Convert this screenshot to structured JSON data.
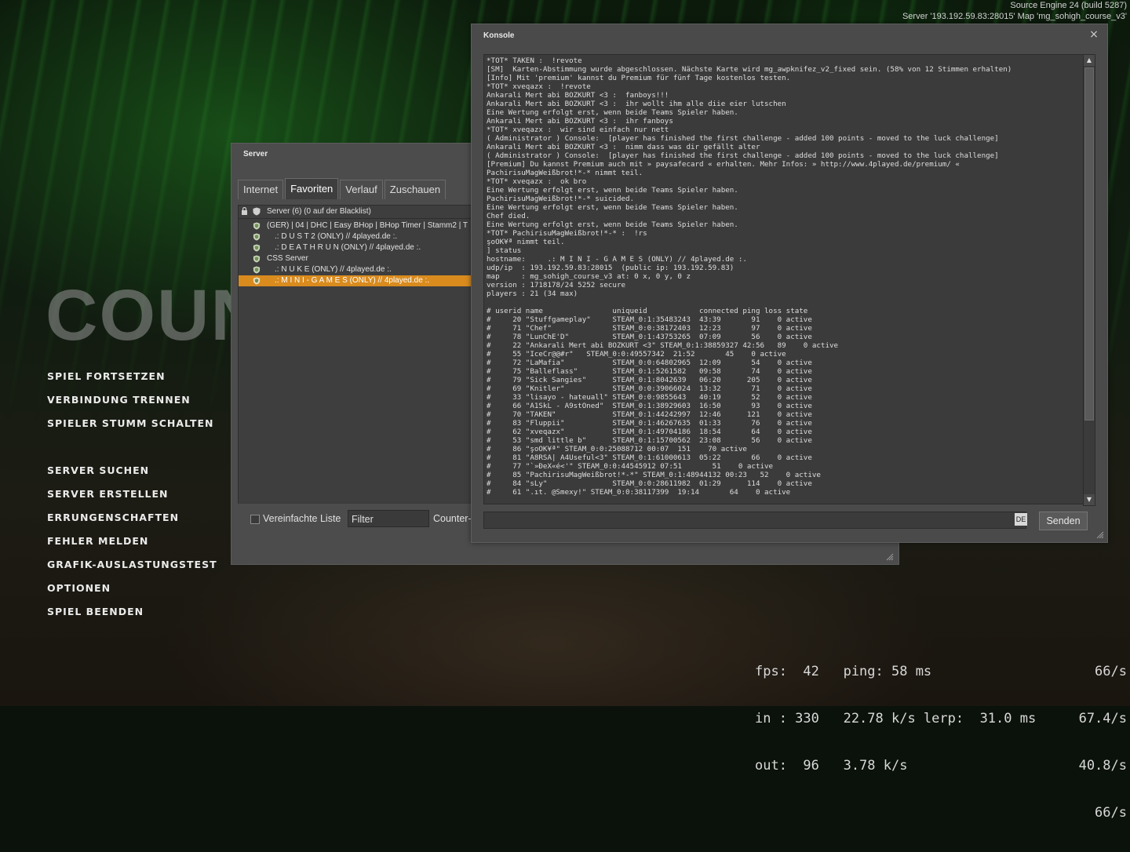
{
  "engine": {
    "line1": "Source Engine 24 (build 5287)",
    "line2": "Server '193.192.59.83:28015' Map 'mg_sohigh_course_v3'"
  },
  "logo": {
    "text": "Counter"
  },
  "menu": {
    "group1": [
      "SPIEL FORTSETZEN",
      "VERBINDUNG TRENNEN",
      "SPIELER STUMM SCHALTEN"
    ],
    "group2": [
      "SERVER SUCHEN",
      "SERVER ERSTELLEN",
      "ERRUNGENSCHAFTEN",
      "FEHLER MELDEN",
      "GRAFIK-AUSLASTUNGSTEST",
      "OPTIONEN",
      "SPIEL BEENDEN"
    ]
  },
  "netgraph": {
    "line1": "fps:  42   ping: 58 ms",
    "line2": "in : 330   22.78 k/s lerp:  31.0 ms",
    "line3": "out:  96   3.78 k/s",
    "rates": [
      "66/s",
      "67.4/s",
      "40.8/s",
      "66/s"
    ]
  },
  "server": {
    "title": "Server",
    "tabs": [
      "Internet",
      "Favoriten",
      "Verlauf",
      "Zuschauen"
    ],
    "header": "Server (6) (0 auf der Blacklist)",
    "rows": [
      "(GER) | 04 | DHC | Easy BHop | BHop Timer | Stamm2 | T",
      ".: D U S T 2 (ONLY) // 4played.de :.",
      ".: D E A T H R U N (ONLY) // 4played.de :.",
      "CSS Server",
      ".: N U K E (ONLY) // 4played.de :.",
      ".: M I N I - G A M E S (ONLY) // 4played.de :."
    ],
    "simplified_label": "Vereinfachte Liste",
    "filter_placeholder": "Filter",
    "game_label": "Counter-"
  },
  "console": {
    "title": "Konsole",
    "close_glyph": "×",
    "lines": [
      "*TOT* TAKEN :  !revote",
      "[SM]  Karten-Abstimmung wurde abgeschlossen. Nächste Karte wird mg_awpknifez_v2_fixed sein. (58% von 12 Stimmen erhalten)",
      "[Info] Mit 'premium' kannst du Premium für fünf Tage kostenlos testen.",
      "*TOT* xveqazx :  !revote",
      "Ankarali Mert abi BOZKURT <3 :  fanboys!!!",
      "Ankarali Mert abi BOZKURT <3 :  ihr wollt ihm alle diie eier lutschen",
      "Eine Wertung erfolgt erst, wenn beide Teams Spieler haben.",
      "Ankarali Mert abi BOZKURT <3 :  ihr fanboys",
      "*TOT* xveqazx :  wir sind einfach nur nett",
      "( Administrator ) Console:  [player has finished the first challenge - added 100 points - moved to the luck challenge]",
      "Ankarali Mert abi BOZKURT <3 :  nimm dass was dir gefällt alter",
      "( Administrator ) Console:  [player has finished the first challenge - added 100 points - moved to the luck challenge]",
      "[Premium] Du kannst Premium auch mit » paysafecard « erhalten. Mehr Infos: » http://www.4played.de/premium/ «",
      "PachirisuMagWeißbrot!*-* nimmt teil.",
      "*TOT* xveqazx :  ok bro",
      "Eine Wertung erfolgt erst, wenn beide Teams Spieler haben.",
      "PachirisuMagWeißbrot!*-* suicided.",
      "Eine Wertung erfolgt erst, wenn beide Teams Spieler haben.",
      "Chef died.",
      "Eine Wertung erfolgt erst, wenn beide Teams Spieler haben.",
      "*TOT* PachirisuMagWeißbrot!*-* :  !rs",
      "şoOK¥ª nimmt teil.",
      "] status",
      "hostname:     .: M I N I - G A M E S (ONLY) // 4played.de :.",
      "udp/ip  : 193.192.59.83:28015  (public ip: 193.192.59.83)",
      "map     : mg_sohigh_course_v3 at: 0 x, 0 y, 0 z",
      "version : 1718178/24 5252 secure",
      "players : 21 (34 max)",
      "",
      "# userid name                uniqueid            connected ping loss state",
      "#     20 \"Stuffgameplay\"     STEAM_0:1:35483243  43:39       91    0 active",
      "#     71 \"Chef\"              STEAM_0:0:38172403  12:23       97    0 active",
      "#     78 \"LunChE'D\"          STEAM_0:1:43753265  07:09       56    0 active",
      "#     22 \"Ankarali Mert abi BOZKURT <3\" STEAM_0:1:38859327 42:56   89    0 active",
      "#     55 \"IceCr@@#r\"   STEAM_0:0:49557342  21:52       45    0 active",
      "#     72 \"LaMafia\"           STEAM_0:0:64802965  12:09       54    0 active",
      "#     75 \"Balleflass\"        STEAM_0:1:5261582   09:58       74    0 active",
      "#     79 \"Sick Sangies\"      STEAM_0:1:8042639   06:20      205    0 active",
      "#     69 \"Knitler\"           STEAM_0:0:39066024  13:32       71    0 active",
      "#     33 \"lisayo - hateuall\" STEAM_0:0:9855643   40:19       52    0 active",
      "#     66 \"A1SkL - A9stOned\"  STEAM_0:1:38929603  16:50       93    0 active",
      "#     70 \"TAKEN\"             STEAM_0:1:44242997  12:46      121    0 active",
      "#     83 \"Fluppii\"           STEAM_0:1:46267635  01:33       76    0 active",
      "#     62 \"xveqazx\"           STEAM_0:1:49704186  18:54       64    0 active",
      "#     53 \"smd little b\"      STEAM_0:1:15700562  23:08       56    0 active",
      "#     86 \"şoOK¥ª\" STEAM_0:0:25088712 00:07  151    70 active",
      "#     81 \"A8RSA| A4Useful<3\" STEAM_0:1:61000613  05:22       66    0 active",
      "#     77 \"`»ÐeX«é<'\" STEAM_0:0:44545912 07:51       51    0 active",
      "#     85 \"PachirisuMagWeißbrot!*-*\" STEAM_0:1:48944132 00:23   52    0 active",
      "#     84 \"sLy\"               STEAM_0:0:28611982  01:29      114    0 active",
      "#     61 \".ıt. @Smexy!\" STEAM_0:0:38117399  19:14       64    0 active"
    ],
    "input_value": "",
    "lang": "DE",
    "send_label": "Senden"
  },
  "colors": {
    "selection": "#d98b1e",
    "panel": "#4a4a4a",
    "panel_dark": "#3b3b3b"
  }
}
